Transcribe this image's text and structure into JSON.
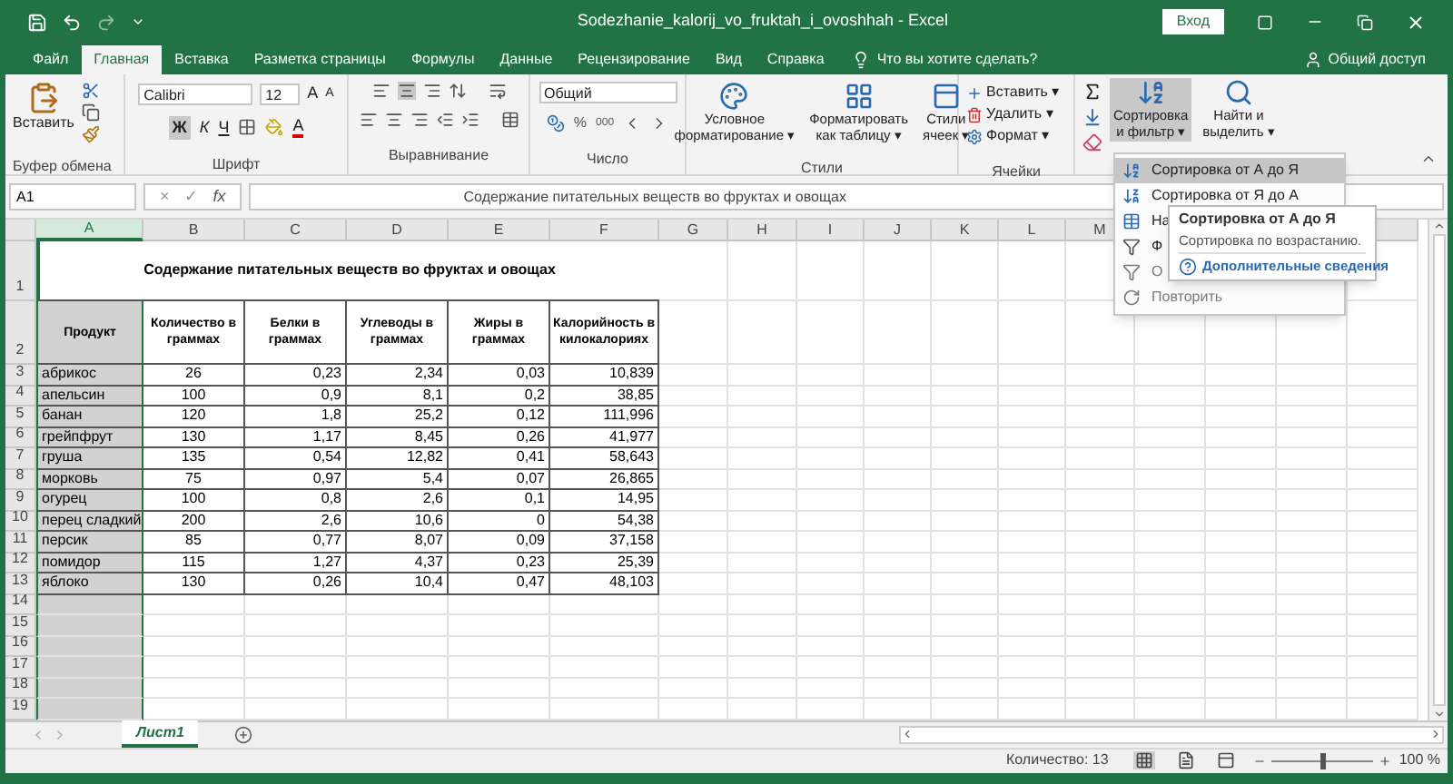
{
  "title_bar": {
    "title": "Sodezhanie_kalorij_vo_fruktah_i_ovoshhah  -  Excel",
    "sign_in": "Вход"
  },
  "tabs": [
    {
      "label": "Файл",
      "selected": false
    },
    {
      "label": "Главная",
      "selected": true
    },
    {
      "label": "Вставка",
      "selected": false
    },
    {
      "label": "Разметка страницы",
      "selected": false
    },
    {
      "label": "Формулы",
      "selected": false
    },
    {
      "label": "Данные",
      "selected": false
    },
    {
      "label": "Рецензирование",
      "selected": false
    },
    {
      "label": "Вид",
      "selected": false
    },
    {
      "label": "Справка",
      "selected": false
    }
  ],
  "tell_me": "Что вы хотите сделать?",
  "share": "Общий доступ",
  "ribbon": {
    "clipboard": {
      "paste": "Вставить",
      "label": "Буфер обмена"
    },
    "font": {
      "name": "Calibri",
      "size": "12",
      "grow": "A",
      "shrink": "A",
      "bold": "Ж",
      "italic": "К",
      "underline": "Ч",
      "font_color_letter": "A",
      "label": "Шрифт"
    },
    "alignment": {
      "label": "Выравнивание"
    },
    "number": {
      "format": "Общий",
      "percent": "%",
      "thousands": "000",
      "label": "Число"
    },
    "styles": {
      "buttons": [
        {
          "lines": [
            "Условное",
            "форматирование ▾"
          ]
        },
        {
          "lines": [
            "Форматировать",
            "как таблицу ▾"
          ]
        },
        {
          "lines": [
            "Стили",
            "ячеек ▾"
          ]
        }
      ],
      "label": "Стили"
    },
    "cells": {
      "buttons": [
        "Вставить ▾",
        "Удалить ▾",
        "Формат ▾"
      ],
      "label": "Ячейки"
    },
    "editing": {
      "buttons": [
        {
          "lines": [
            "Сортировка",
            "и фильтр ▾"
          ],
          "pressed": true
        },
        {
          "lines": [
            "Найти и",
            "выделить ▾"
          ],
          "pressed": false
        }
      ]
    }
  },
  "formula_bar": {
    "name_box": "A1",
    "cancel": "×",
    "enter": "✓",
    "fx": "fx",
    "value": "Содержание питательных веществ во фруктах и овощах"
  },
  "sheet": {
    "columns": [
      {
        "label": "A",
        "selected": true
      },
      {
        "label": "B",
        "selected": false
      },
      {
        "label": "C",
        "selected": false
      },
      {
        "label": "D",
        "selected": false
      },
      {
        "label": "E",
        "selected": false
      },
      {
        "label": "F",
        "selected": false
      },
      {
        "label": "G",
        "selected": false
      },
      {
        "label": "H",
        "selected": false
      },
      {
        "label": "I",
        "selected": false
      },
      {
        "label": "J",
        "selected": false
      },
      {
        "label": "K",
        "selected": false
      },
      {
        "label": "L",
        "selected": false
      },
      {
        "label": "M",
        "selected": false
      }
    ],
    "row_numbers": [
      "1",
      "2",
      "3",
      "4",
      "5",
      "6",
      "7",
      "8",
      "9",
      "10",
      "11",
      "12",
      "13",
      "14",
      "15",
      "16",
      "17",
      "18",
      "19"
    ],
    "title": "Содержание питательных веществ во фруктах и овощах",
    "header": [
      "Продукт",
      "Количество в граммах",
      "Белки в граммах",
      "Углеводы в граммах",
      "Жиры в граммах",
      "Калорийность в килокалориях"
    ],
    "rows": [
      [
        "абрикос",
        "26",
        "0,23",
        "2,34",
        "0,03",
        "10,839"
      ],
      [
        "апельсин",
        "100",
        "0,9",
        "8,1",
        "0,2",
        "38,85"
      ],
      [
        "банан",
        "120",
        "1,8",
        "25,2",
        "0,12",
        "111,996"
      ],
      [
        "грейпфрут",
        "130",
        "1,17",
        "8,45",
        "0,26",
        "41,977"
      ],
      [
        "груша",
        "135",
        "0,54",
        "12,82",
        "0,41",
        "58,643"
      ],
      [
        "морковь",
        "75",
        "0,97",
        "5,4",
        "0,07",
        "26,865"
      ],
      [
        "огурец",
        "100",
        "0,8",
        "2,6",
        "0,1",
        "14,95"
      ],
      [
        "перец сладкий",
        "200",
        "2,6",
        "10,6",
        "0",
        "54,38"
      ],
      [
        "персик",
        "85",
        "0,77",
        "8,07",
        "0,09",
        "37,158"
      ],
      [
        "помидор",
        "115",
        "1,27",
        "4,37",
        "0,23",
        "25,39"
      ],
      [
        "яблоко",
        "130",
        "0,26",
        "10,4",
        "0,47",
        "48,103"
      ]
    ]
  },
  "sheet_tabs": [
    {
      "label": "Лист1",
      "selected": true
    }
  ],
  "status_bar": {
    "count": "Количество: 13",
    "zoom": "100 %",
    "level": 0.5
  },
  "sort_menu": {
    "items": [
      {
        "label": "Сортировка от А до Я",
        "highlighted": true,
        "disabled": false
      },
      {
        "label": "Сортировка от Я до А",
        "highlighted": false,
        "disabled": false
      },
      {
        "label": "На",
        "highlighted": false,
        "disabled": false
      },
      {
        "label": "Ф",
        "highlighted": false,
        "disabled": false
      },
      {
        "label": "О",
        "highlighted": false,
        "disabled": true
      },
      {
        "label": "Повторить",
        "highlighted": false,
        "disabled": true
      }
    ]
  },
  "tooltip": {
    "title": "Сортировка от А до Я",
    "text": "Сортировка по возрастанию.",
    "link": "Дополнительные сведения"
  }
}
